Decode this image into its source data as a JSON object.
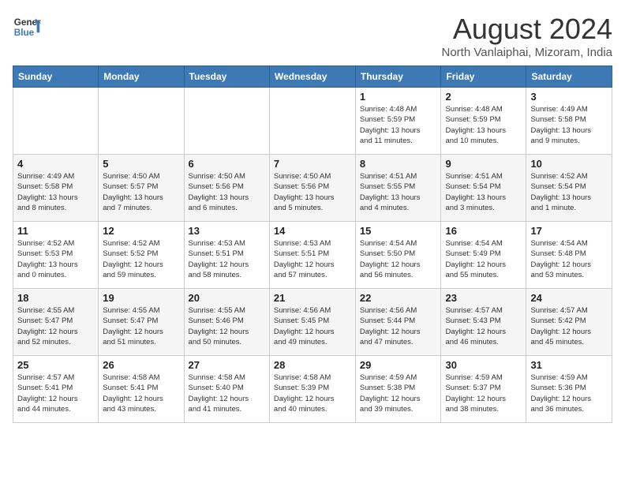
{
  "logo": {
    "line1": "General",
    "line2": "Blue"
  },
  "title": "August 2024",
  "location": "North Vanlaiphai, Mizoram, India",
  "days_of_week": [
    "Sunday",
    "Monday",
    "Tuesday",
    "Wednesday",
    "Thursday",
    "Friday",
    "Saturday"
  ],
  "weeks": [
    [
      {
        "day": "",
        "info": ""
      },
      {
        "day": "",
        "info": ""
      },
      {
        "day": "",
        "info": ""
      },
      {
        "day": "",
        "info": ""
      },
      {
        "day": "1",
        "info": "Sunrise: 4:48 AM\nSunset: 5:59 PM\nDaylight: 13 hours\nand 11 minutes."
      },
      {
        "day": "2",
        "info": "Sunrise: 4:48 AM\nSunset: 5:59 PM\nDaylight: 13 hours\nand 10 minutes."
      },
      {
        "day": "3",
        "info": "Sunrise: 4:49 AM\nSunset: 5:58 PM\nDaylight: 13 hours\nand 9 minutes."
      }
    ],
    [
      {
        "day": "4",
        "info": "Sunrise: 4:49 AM\nSunset: 5:58 PM\nDaylight: 13 hours\nand 8 minutes."
      },
      {
        "day": "5",
        "info": "Sunrise: 4:50 AM\nSunset: 5:57 PM\nDaylight: 13 hours\nand 7 minutes."
      },
      {
        "day": "6",
        "info": "Sunrise: 4:50 AM\nSunset: 5:56 PM\nDaylight: 13 hours\nand 6 minutes."
      },
      {
        "day": "7",
        "info": "Sunrise: 4:50 AM\nSunset: 5:56 PM\nDaylight: 13 hours\nand 5 minutes."
      },
      {
        "day": "8",
        "info": "Sunrise: 4:51 AM\nSunset: 5:55 PM\nDaylight: 13 hours\nand 4 minutes."
      },
      {
        "day": "9",
        "info": "Sunrise: 4:51 AM\nSunset: 5:54 PM\nDaylight: 13 hours\nand 3 minutes."
      },
      {
        "day": "10",
        "info": "Sunrise: 4:52 AM\nSunset: 5:54 PM\nDaylight: 13 hours\nand 1 minute."
      }
    ],
    [
      {
        "day": "11",
        "info": "Sunrise: 4:52 AM\nSunset: 5:53 PM\nDaylight: 13 hours\nand 0 minutes."
      },
      {
        "day": "12",
        "info": "Sunrise: 4:52 AM\nSunset: 5:52 PM\nDaylight: 12 hours\nand 59 minutes."
      },
      {
        "day": "13",
        "info": "Sunrise: 4:53 AM\nSunset: 5:51 PM\nDaylight: 12 hours\nand 58 minutes."
      },
      {
        "day": "14",
        "info": "Sunrise: 4:53 AM\nSunset: 5:51 PM\nDaylight: 12 hours\nand 57 minutes."
      },
      {
        "day": "15",
        "info": "Sunrise: 4:54 AM\nSunset: 5:50 PM\nDaylight: 12 hours\nand 56 minutes."
      },
      {
        "day": "16",
        "info": "Sunrise: 4:54 AM\nSunset: 5:49 PM\nDaylight: 12 hours\nand 55 minutes."
      },
      {
        "day": "17",
        "info": "Sunrise: 4:54 AM\nSunset: 5:48 PM\nDaylight: 12 hours\nand 53 minutes."
      }
    ],
    [
      {
        "day": "18",
        "info": "Sunrise: 4:55 AM\nSunset: 5:47 PM\nDaylight: 12 hours\nand 52 minutes."
      },
      {
        "day": "19",
        "info": "Sunrise: 4:55 AM\nSunset: 5:47 PM\nDaylight: 12 hours\nand 51 minutes."
      },
      {
        "day": "20",
        "info": "Sunrise: 4:55 AM\nSunset: 5:46 PM\nDaylight: 12 hours\nand 50 minutes."
      },
      {
        "day": "21",
        "info": "Sunrise: 4:56 AM\nSunset: 5:45 PM\nDaylight: 12 hours\nand 49 minutes."
      },
      {
        "day": "22",
        "info": "Sunrise: 4:56 AM\nSunset: 5:44 PM\nDaylight: 12 hours\nand 47 minutes."
      },
      {
        "day": "23",
        "info": "Sunrise: 4:57 AM\nSunset: 5:43 PM\nDaylight: 12 hours\nand 46 minutes."
      },
      {
        "day": "24",
        "info": "Sunrise: 4:57 AM\nSunset: 5:42 PM\nDaylight: 12 hours\nand 45 minutes."
      }
    ],
    [
      {
        "day": "25",
        "info": "Sunrise: 4:57 AM\nSunset: 5:41 PM\nDaylight: 12 hours\nand 44 minutes."
      },
      {
        "day": "26",
        "info": "Sunrise: 4:58 AM\nSunset: 5:41 PM\nDaylight: 12 hours\nand 43 minutes."
      },
      {
        "day": "27",
        "info": "Sunrise: 4:58 AM\nSunset: 5:40 PM\nDaylight: 12 hours\nand 41 minutes."
      },
      {
        "day": "28",
        "info": "Sunrise: 4:58 AM\nSunset: 5:39 PM\nDaylight: 12 hours\nand 40 minutes."
      },
      {
        "day": "29",
        "info": "Sunrise: 4:59 AM\nSunset: 5:38 PM\nDaylight: 12 hours\nand 39 minutes."
      },
      {
        "day": "30",
        "info": "Sunrise: 4:59 AM\nSunset: 5:37 PM\nDaylight: 12 hours\nand 38 minutes."
      },
      {
        "day": "31",
        "info": "Sunrise: 4:59 AM\nSunset: 5:36 PM\nDaylight: 12 hours\nand 36 minutes."
      }
    ]
  ]
}
